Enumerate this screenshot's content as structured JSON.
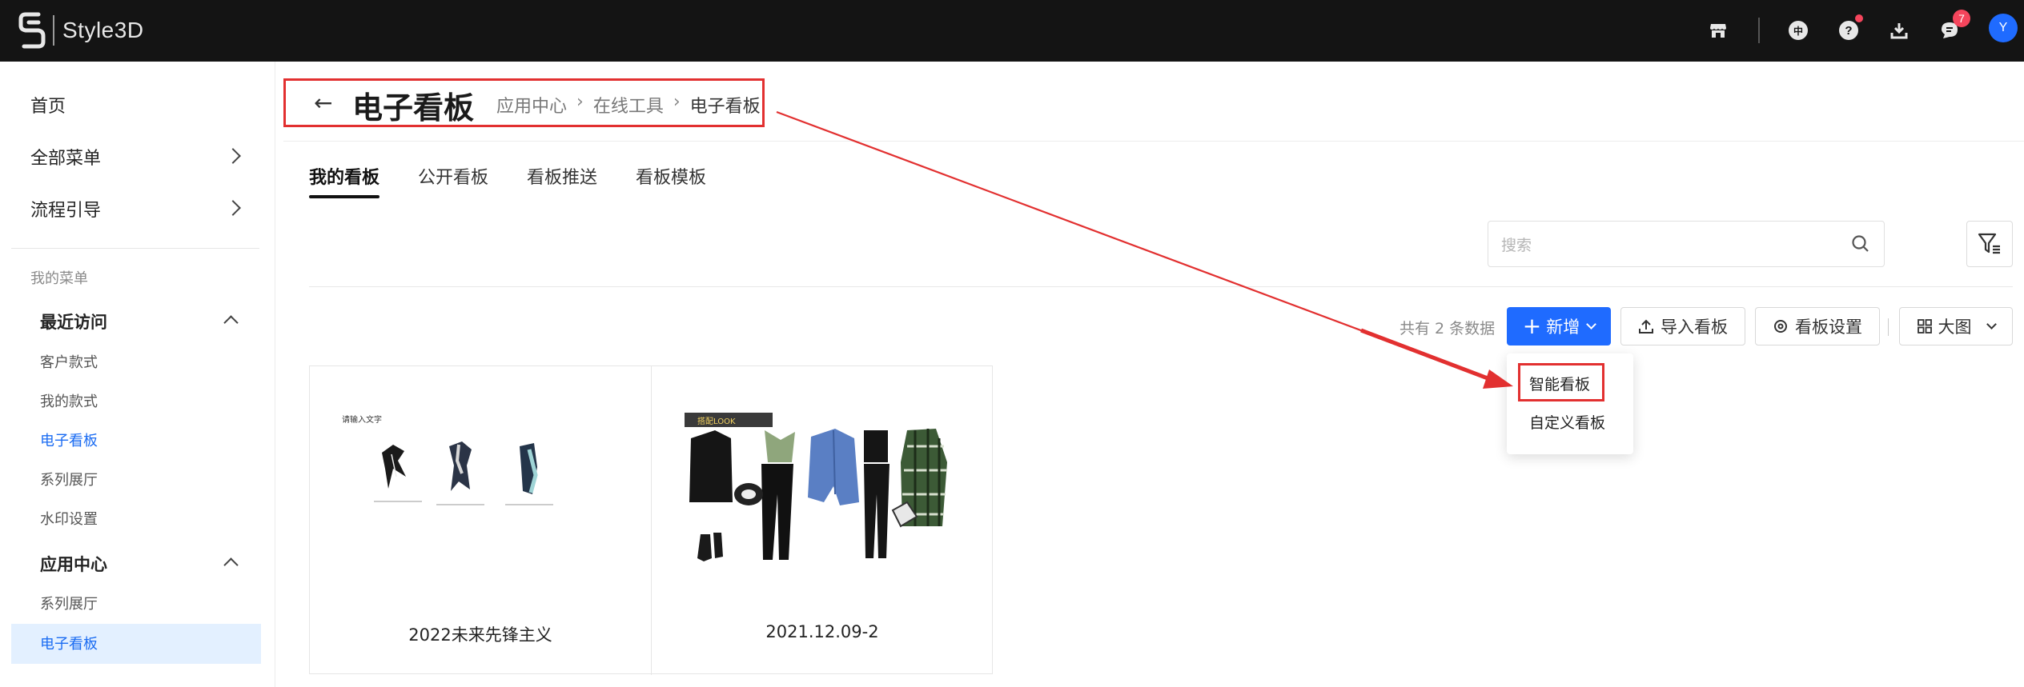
{
  "app": {
    "name": "Style3D"
  },
  "topbar": {
    "icons": [
      "store-icon",
      "language-icon",
      "help-icon",
      "download-icon",
      "message-icon"
    ],
    "language_label": "中",
    "help_label": "?",
    "message_badge": "7",
    "avatar_initial": "Y",
    "accent": "#1f6bff"
  },
  "sidebar": {
    "top_items": [
      {
        "label": "首页"
      },
      {
        "label": "全部菜单"
      },
      {
        "label": "流程引导"
      }
    ],
    "section_label": "我的菜单",
    "groups": [
      {
        "label": "最近访问",
        "items": [
          "客户款式",
          "我的款式",
          "电子看板",
          "系列展厅",
          "水印设置"
        ]
      },
      {
        "label": "应用中心",
        "items": [
          "系列展厅",
          "电子看板"
        ]
      }
    ]
  },
  "header": {
    "back_icon": "←",
    "title": "电子看板",
    "breadcrumb": [
      "应用中心",
      "在线工具",
      "电子看板"
    ]
  },
  "tabs": [
    "我的看板",
    "公开看板",
    "看板推送",
    "看板模板"
  ],
  "search": {
    "placeholder": "搜索"
  },
  "toolbar": {
    "count_text": "共有 2 条数据",
    "add_label": "新增",
    "import_label": "导入看板",
    "settings_label": "看板设置",
    "view_label": "大图"
  },
  "add_dropdown": {
    "items": [
      "智能看板",
      "自定义看板"
    ]
  },
  "cards": [
    {
      "title": "2022未来先锋主义",
      "thumb_caption": "请输入文字"
    },
    {
      "title": "2021.12.09-2",
      "thumb_caption": "搭配LOOK"
    }
  ],
  "annotation_color": "#e23030"
}
